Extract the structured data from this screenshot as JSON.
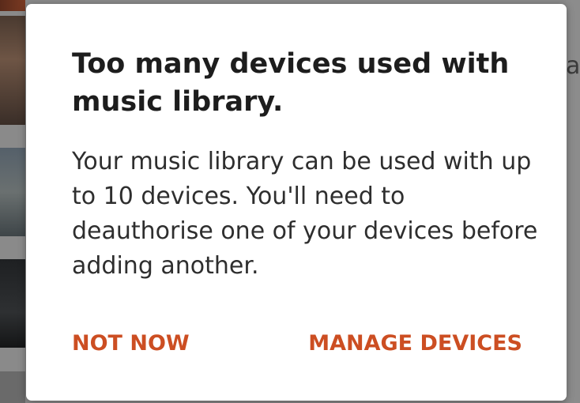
{
  "background": {
    "right_text": "a."
  },
  "dialog": {
    "title": "Too many devices used with music library.",
    "message": "Your music library can be used with up to 10 devices. You'll need to deauthorise one of your devices before adding another.",
    "buttons": {
      "negative_label": "NOT NOW",
      "positive_label": "MANAGE DEVICES"
    }
  },
  "colors": {
    "accent": "#cc4e22",
    "scrim": "#7a7a7a",
    "dialog_background": "#ffffff",
    "title_text": "#1d1d1d"
  }
}
